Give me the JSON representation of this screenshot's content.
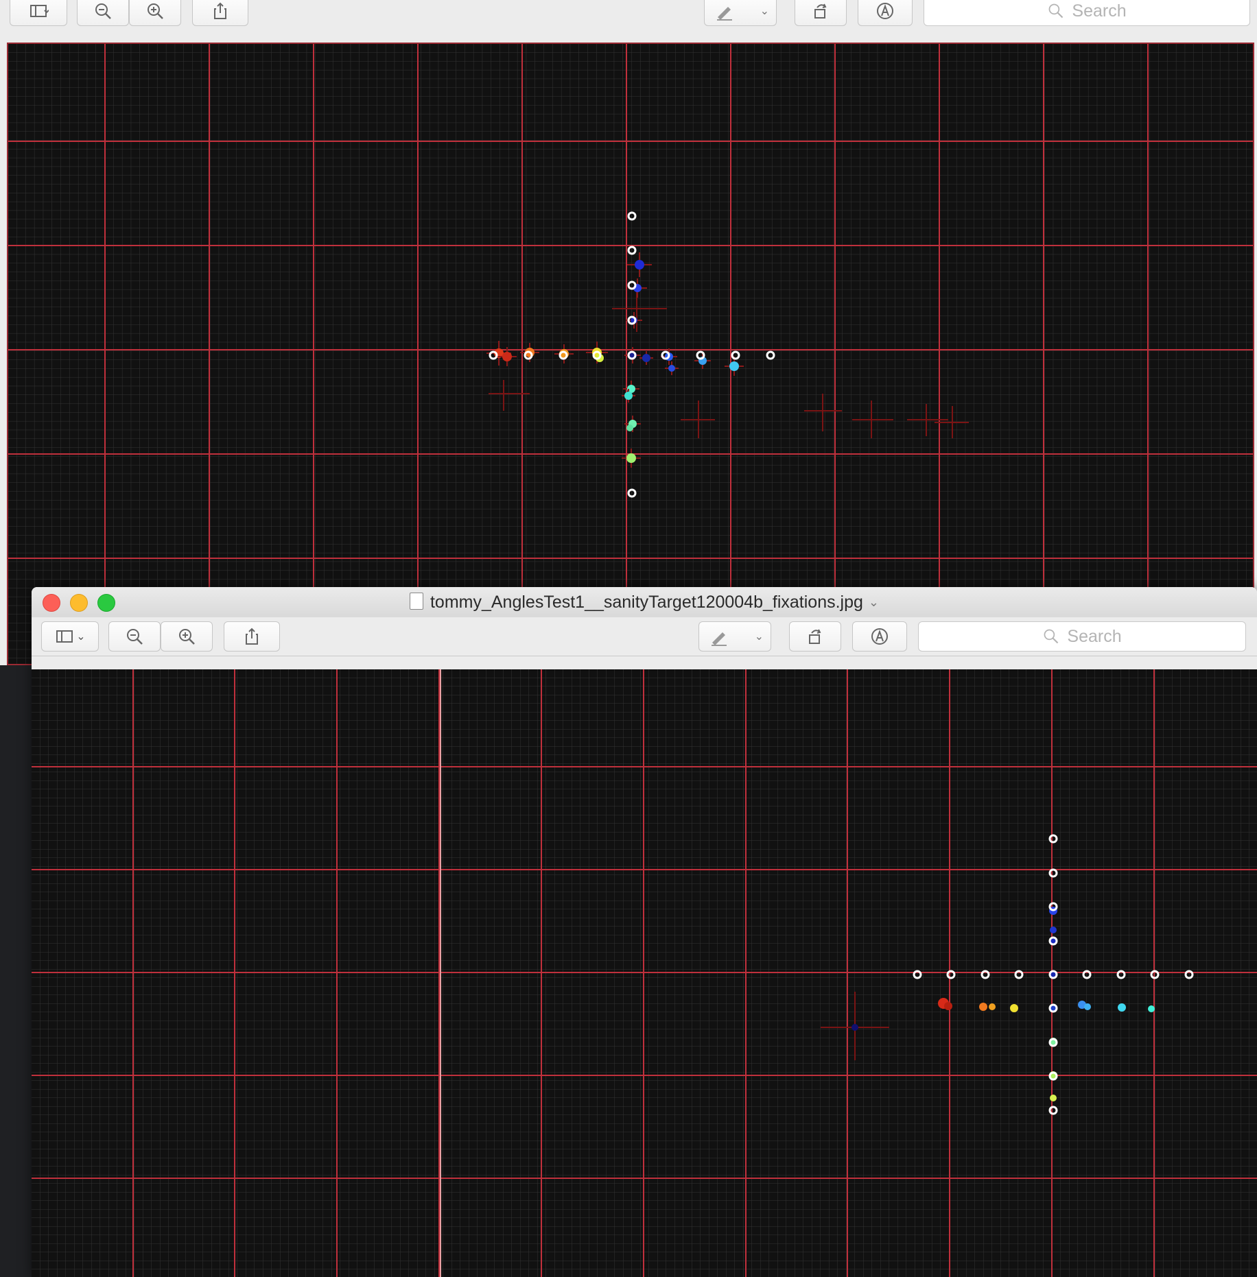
{
  "windows": {
    "back": {
      "toolbar": {
        "search_placeholder": "Search"
      }
    },
    "front": {
      "title": "tommy_AnglesTest1__sanityTarget120004b_fixations.jpg",
      "toolbar": {
        "search_placeholder": "Search"
      }
    }
  },
  "icons": {
    "sidebar": "sidebar-icon",
    "zoom_out": "zoom-out-icon",
    "zoom_in": "zoom-in-icon",
    "share": "share-icon",
    "markup": "pen-icon",
    "rotate": "rotate-icon",
    "annotate": "annotate-icon",
    "search": "search-icon"
  },
  "colors": {
    "grid_major": "#c0303c",
    "grid_minor": "#3a3a3a",
    "background": "#111111",
    "target": "#ffffff"
  }
}
